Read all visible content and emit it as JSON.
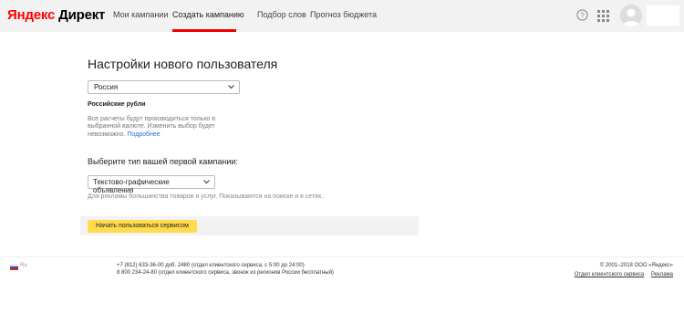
{
  "header": {
    "logo_brand": "Яндекс",
    "logo_product": "Директ",
    "nav": [
      {
        "label": "Мои кампании"
      },
      {
        "label": "Создать кампанию",
        "active": true
      },
      {
        "label": "Подбор слов"
      },
      {
        "label": "Прогноз бюджета"
      }
    ],
    "icons": [
      "help-icon",
      "apps-grid-icon",
      "avatar"
    ]
  },
  "main": {
    "title": "Настройки нового пользователя",
    "country": {
      "selected": "Россия"
    },
    "currency": {
      "title": "Российские рубли",
      "note": "Все расчеты будут производиться только в выбранной валюте. Изменить выбор будет невозможно.",
      "more_link": "Подробнее"
    },
    "campaign": {
      "title": "Выберите тип вашей первой кампании:",
      "selected": "Текстово-графические объявления",
      "note": "Для рекламы большинства товаров и услуг. Показываются на поиске и в сетях."
    },
    "start_button": "Начать пользоваться сервисом"
  },
  "footer": {
    "region": "Ru",
    "phone1": "+7 (812) 633-36-00 доб. 2480 (отдел клиентского сервиса, с 5:00 до 24:00)",
    "phone2": "8 800 234-24-80 (отдел клиентского сервиса, звонок из регионов России бесплатный)",
    "copyright": "© 2001–2018 ООО «Яндекс»",
    "links": [
      "Отдел клиентского сервиса",
      "Реклама"
    ]
  },
  "colors": {
    "accent_red": "#e00000",
    "button_yellow": "#ffdb4d",
    "link_blue": "#2a6fd6"
  }
}
